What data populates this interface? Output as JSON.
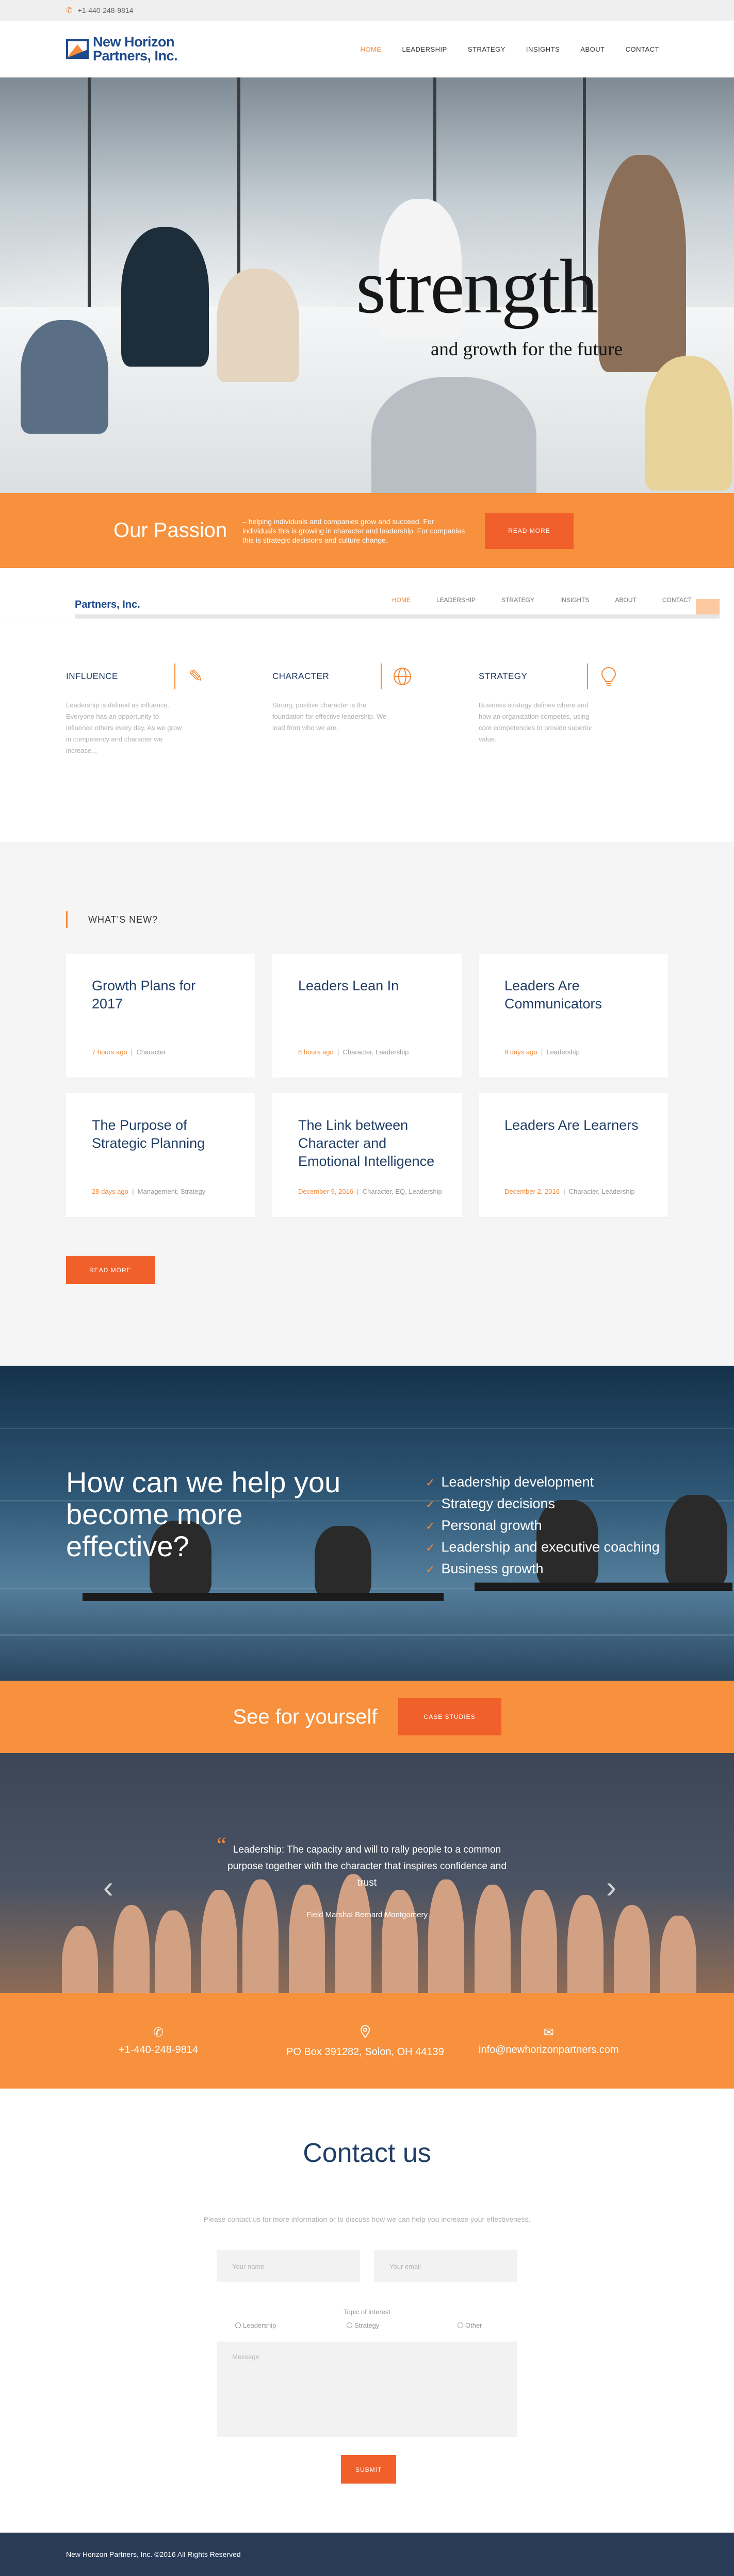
{
  "topbar": {
    "phone": "+1-440-248-9814"
  },
  "brand": {
    "name_line1": "New Horizon",
    "name_line2": "Partners, Inc.",
    "colors": {
      "accent": "#f58a3a",
      "navy": "#1d4a8c"
    }
  },
  "nav": [
    "HOME",
    "LEADERSHIP",
    "STRATEGY",
    "INSIGHTS",
    "ABOUT",
    "CONTACT"
  ],
  "hero": {
    "word": "strength",
    "subtitle": "and growth for the future"
  },
  "passion": {
    "title": "Our Passion",
    "text": "– helping individuals and companies grow and succeed. For individuals this is growing in character and leadership. For companies this is strategic decisions and culture change.",
    "button": "READ MORE"
  },
  "ghost": {
    "logo": "Partners, Inc.",
    "nav": [
      "HOME",
      "LEADERSHIP",
      "STRATEGY",
      "INSIGHTS",
      "ABOUT",
      "CONTACT"
    ]
  },
  "features": [
    {
      "title": "INFLUENCE",
      "icon": "pencil-icon",
      "text": "Leadership is defined as influence. Everyone has an opportunity to influence others every day. As we grow in competency and character we increase..."
    },
    {
      "title": "CHARACTER",
      "icon": "globe-icon",
      "text": "Strong, positive character is the foundation for effective leadership. We lead from who we are."
    },
    {
      "title": "STRATEGY",
      "icon": "lightbulb-icon",
      "text": "Business strategy defines where and how an organization competes, using core competencies to provide superior value."
    }
  ],
  "news": {
    "heading": "WHAT'S NEW?",
    "button": "READ MORE",
    "items": [
      {
        "title": "Growth Plans for 2017",
        "time": "7 hours ago",
        "cats": "Character"
      },
      {
        "title": "Leaders Lean In",
        "time": "8 hours ago",
        "cats": "Character, Leadership"
      },
      {
        "title": "Leaders Are Communicators",
        "time": "8 days ago",
        "cats": "Leadership"
      },
      {
        "title": "The Purpose of Strategic Planning",
        "time": "28 days ago",
        "cats": "Management, Strategy"
      },
      {
        "title": "The Link between Character and Emotional Intelligence",
        "time": "December 9, 2016",
        "cats": "Character, EQ, Leadership"
      },
      {
        "title": "Leaders Are Learners",
        "time": "December 2, 2016",
        "cats": "Character, Leadership"
      }
    ]
  },
  "help": {
    "title": "How can we help you become more effective?",
    "items": [
      "Leadership development",
      "Strategy decisions",
      "Personal growth",
      "Leadership and executive coaching",
      "Business growth"
    ]
  },
  "see": {
    "title": "See for yourself",
    "button": "CASE STUDIES"
  },
  "quote": {
    "text": "Leadership: The capacity and will to rally people to a common purpose together with the character that inspires confidence and trust",
    "author": "Field Marshal Bernard Montgomery"
  },
  "contact_bar": {
    "phone": "+1-440-248-9814",
    "address": "PO Box 391282, Solon, OH 44139",
    "email": "info@newhorizonpartners.com"
  },
  "contact": {
    "title": "Contact us",
    "intro": "Please contact us for more information or to discuss how we can help you increase your effectiveness.",
    "name_placeholder": "Your name",
    "email_placeholder": "Your email",
    "topic_label": "Topic of interest",
    "options": [
      "Leadership",
      "Strategy",
      "Other"
    ],
    "message_placeholder": "Message",
    "submit": "SUBMIT"
  },
  "footer": {
    "text": "New Horizon Partners, Inc. ©2016 All Rights Reserved"
  }
}
